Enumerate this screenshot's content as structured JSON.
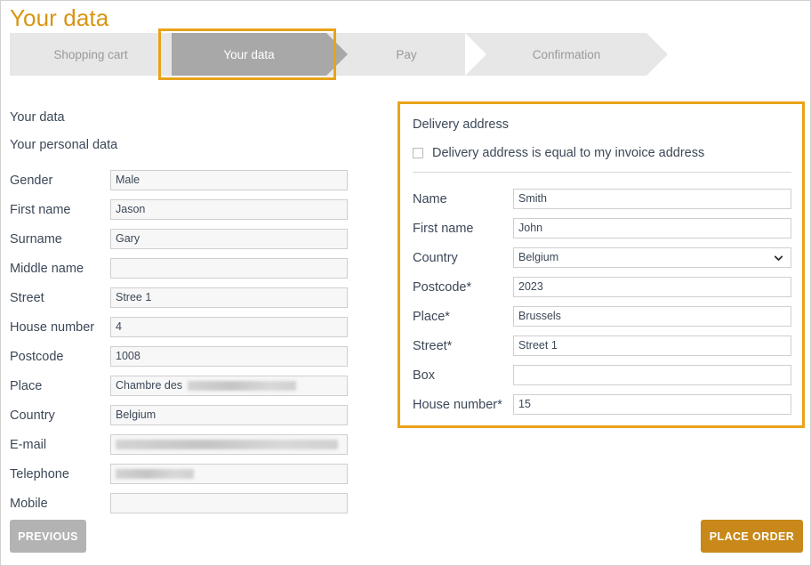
{
  "page": {
    "title": "Your data",
    "accent_color": "#d89512",
    "frame_color": "#e9a319",
    "active_step_bg": "#a8a8a8",
    "inactive_step_bg": "#e7e7e7"
  },
  "steps": [
    {
      "label": "Shopping cart",
      "active": false
    },
    {
      "label": "Your data",
      "active": true
    },
    {
      "label": "Pay",
      "active": false
    },
    {
      "label": "Confirmation",
      "active": false
    }
  ],
  "left": {
    "heading": "Your data",
    "subheading": "Your personal data",
    "fields": [
      {
        "label": "Gender",
        "value": "Male",
        "redacted": false
      },
      {
        "label": "First name",
        "value": "Jason",
        "redacted": false
      },
      {
        "label": "Surname",
        "value": "Gary",
        "redacted": false
      },
      {
        "label": "Middle name",
        "value": "",
        "redacted": false
      },
      {
        "label": "Street",
        "value": "Stree 1",
        "redacted": false
      },
      {
        "label": "House number",
        "value": "4",
        "redacted": false
      },
      {
        "label": "Postcode",
        "value": "1008",
        "redacted": false
      },
      {
        "label": "Place",
        "value": "Chambre des ",
        "redacted": true
      },
      {
        "label": "Country",
        "value": "Belgium",
        "redacted": false
      },
      {
        "label": "E-mail",
        "value": "",
        "redacted": true
      },
      {
        "label": "Telephone",
        "value": "",
        "redacted": true
      },
      {
        "label": "Mobile",
        "value": "",
        "redacted": false
      }
    ]
  },
  "right": {
    "title": "Delivery address",
    "checkbox_label": "Delivery address is equal to my invoice address",
    "checkbox_checked": false,
    "fields": [
      {
        "label": "Name",
        "value": "Smith",
        "type": "text"
      },
      {
        "label": "First name",
        "value": "John",
        "type": "text"
      },
      {
        "label": "Country",
        "value": "Belgium",
        "type": "select"
      },
      {
        "label": "Postcode*",
        "value": "2023",
        "type": "text"
      },
      {
        "label": "Place*",
        "value": "Brussels",
        "type": "text"
      },
      {
        "label": "Street*",
        "value": "Street 1",
        "type": "text"
      },
      {
        "label": "Box",
        "value": "",
        "type": "text"
      },
      {
        "label": "House number*",
        "value": "15",
        "type": "text"
      }
    ]
  },
  "buttons": {
    "previous": "PREVIOUS",
    "place_order": "PLACE ORDER"
  }
}
